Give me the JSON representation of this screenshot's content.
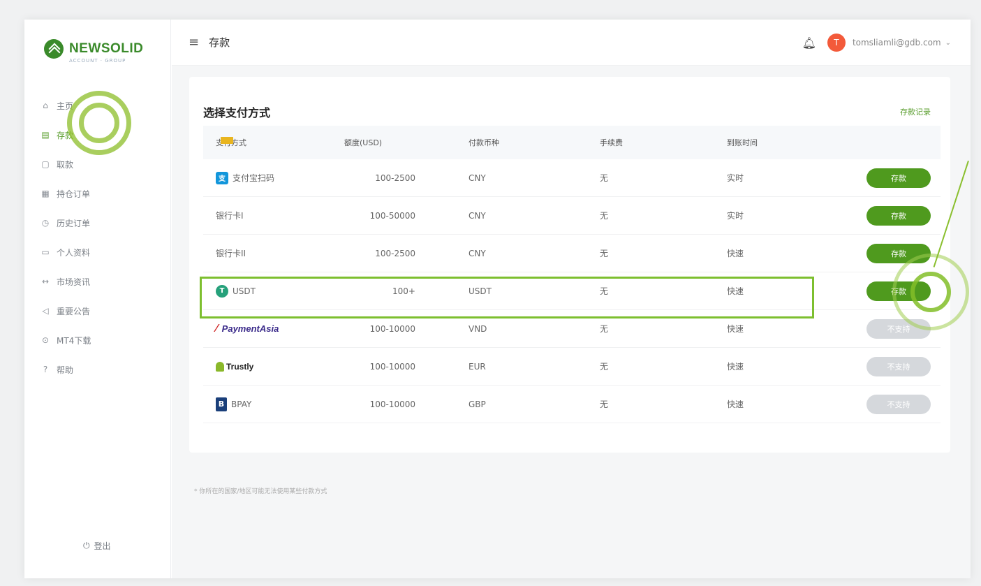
{
  "brand": {
    "name": "NEWSOLID",
    "tagline": "ACCOUNT · GROUP"
  },
  "header": {
    "title": "存款",
    "avatar_letter": "T",
    "user_email": "tomsliamli@gdb.com",
    "menu_icon": "hamburger-icon",
    "bell_icon": "bell-icon"
  },
  "sidebar": {
    "items": [
      {
        "label": "主页",
        "icon": "home-icon",
        "glyph": "⌂",
        "active": false
      },
      {
        "label": "存款",
        "icon": "deposit-icon",
        "glyph": "▤",
        "active": true
      },
      {
        "label": "取款",
        "icon": "withdraw-icon",
        "glyph": "▢",
        "active": false
      },
      {
        "label": "持仓订单",
        "icon": "positions-icon",
        "glyph": "▦",
        "active": false
      },
      {
        "label": "历史订单",
        "icon": "history-icon",
        "glyph": "◷",
        "active": false
      },
      {
        "label": "个人资料",
        "icon": "profile-icon",
        "glyph": "▭",
        "active": false
      },
      {
        "label": "市场资讯",
        "icon": "news-icon",
        "glyph": "↔",
        "active": false
      },
      {
        "label": "重要公告",
        "icon": "announcement-icon",
        "glyph": "◁",
        "active": false
      },
      {
        "label": "MT4下载",
        "icon": "download-icon",
        "glyph": "⊙",
        "active": false
      },
      {
        "label": "帮助",
        "icon": "help-icon",
        "glyph": "?",
        "active": false
      }
    ],
    "logout_label": "登出"
  },
  "card": {
    "title": "选择支付方式",
    "records_link": "存款记录",
    "columns": [
      "支付方式",
      "额度(USD)",
      "付款币种",
      "手续费",
      "到账时间",
      ""
    ],
    "rows": [
      {
        "method": "支付宝扫码",
        "logo": "alipay",
        "limit": "100-2500",
        "currency": "CNY",
        "fee": "无",
        "time": "实时",
        "action": "存款",
        "enabled": true
      },
      {
        "method": "银行卡I",
        "logo": "card",
        "limit": "100-50000",
        "currency": "CNY",
        "fee": "无",
        "time": "实时",
        "action": "存款",
        "enabled": true
      },
      {
        "method": "银行卡II",
        "logo": "card",
        "limit": "100-2500",
        "currency": "CNY",
        "fee": "无",
        "time": "快速",
        "action": "存款",
        "enabled": true
      },
      {
        "method": "USDT",
        "logo": "usdt",
        "limit": "100+",
        "currency": "USDT",
        "fee": "无",
        "time": "快速",
        "action": "存款",
        "enabled": true
      },
      {
        "method": "PaymentAsia",
        "logo": "paymentasia",
        "limit": "100-10000",
        "currency": "VND",
        "fee": "无",
        "time": "快速",
        "action": "不支持",
        "enabled": false
      },
      {
        "method": "Trustly",
        "logo": "trustly",
        "limit": "100-10000",
        "currency": "EUR",
        "fee": "无",
        "time": "快速",
        "action": "不支持",
        "enabled": false
      },
      {
        "method": "BPAY",
        "logo": "bpay",
        "limit": "100-10000",
        "currency": "GBP",
        "fee": "无",
        "time": "快速",
        "action": "不支持",
        "enabled": false
      }
    ]
  },
  "footnote": "* 你所在的国家/地区可能无法使用某些付款方式",
  "colors": {
    "accent": "#4f9a1e",
    "highlight": "#7dbf2f",
    "disabled": "#d5d8dc"
  }
}
